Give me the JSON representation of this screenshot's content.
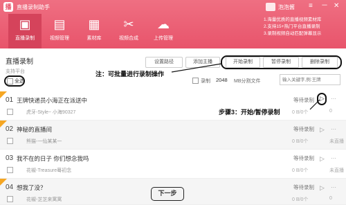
{
  "app": {
    "title": "直播录制助手",
    "user": "泡泡酱",
    "logo": "播"
  },
  "window": {
    "min": "－",
    "close": "✕",
    "menu": "≡"
  },
  "notes": [
    "1.海量优质的直播视频素材库",
    "2.支持15+热门平台直播录制",
    "3.录制视频自动匹配弹幕显示"
  ],
  "nav": [
    {
      "label": "直播录制",
      "icon": "▣"
    },
    {
      "label": "视频管理",
      "icon": "▤"
    },
    {
      "label": "素材库",
      "icon": "▦"
    },
    {
      "label": "视频合成",
      "icon": "✂"
    },
    {
      "label": "上传管理",
      "icon": "☁"
    }
  ],
  "page": {
    "title": "直播录制",
    "support": "支持平台",
    "select_all": "全选"
  },
  "toolbar": {
    "set_path": "设置路径",
    "add_host": "添加主播",
    "start": "开始录制",
    "pause": "暂停录制",
    "delete": "删除录制",
    "split_label": "录制",
    "split_value": "2048",
    "split_unit": "MB分割文件",
    "search_placeholder": "输入关键字,例:王牌"
  },
  "annotations": {
    "batch": "注：可批量进行录制操作",
    "step3": "步骤3：开始/暂停录制"
  },
  "rows": [
    {
      "num": "01",
      "title": "王牌快递员小海正在派送中",
      "anchor": "虎牙-Style~ 小海90327",
      "status": "等待录制",
      "size": "0 B/0个",
      "extra": "0"
    },
    {
      "num": "02",
      "title": "神秘的直播间",
      "anchor": "熊猫-一仙某某一",
      "status": "等待录制",
      "size": "0 B/0个",
      "extra": "未直播"
    },
    {
      "num": "03",
      "title": "我不在的日子 你们想念我吗",
      "anchor": "花椒-Treasure蓦初念",
      "status": "等待录制",
      "size": "0 B/0个",
      "extra": "未直播"
    },
    {
      "num": "04",
      "title": "想我了没？",
      "anchor": "花椒-芝芝来寓寓",
      "status": "等待录制",
      "size": "0 B/0个",
      "extra": "0"
    }
  ],
  "next": "下一步"
}
